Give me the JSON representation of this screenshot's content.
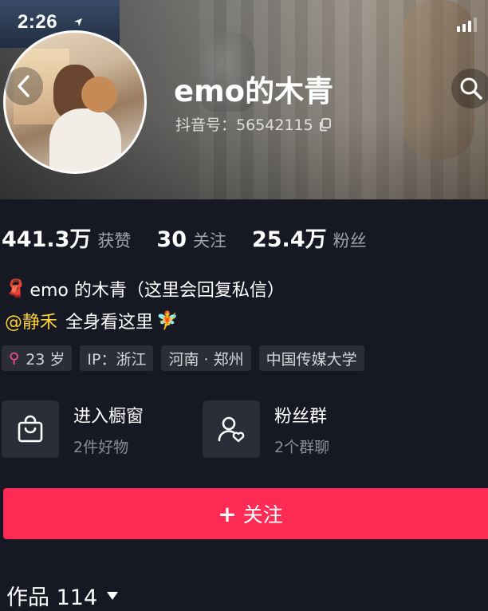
{
  "status_bar": {
    "time": "2:26"
  },
  "header": {
    "name": "emo的木青",
    "douyin_id": "抖音号：56542115"
  },
  "stats": [
    {
      "value": "441.3万",
      "label": "获赞"
    },
    {
      "value": "30",
      "label": "关注"
    },
    {
      "value": "25.4万",
      "label": "粉丝"
    }
  ],
  "bio": {
    "line1_emoji": "🧣",
    "line1_text": "emo 的木青（这里会回复私信）",
    "mention": "@静禾",
    "line2_text": "全身看这里",
    "line2_emoji": "🧚"
  },
  "tags": [
    {
      "icon": "female-symbol-icon",
      "text": "23 岁"
    },
    {
      "text": "IP：浙江"
    },
    {
      "text": "河南 · 郑州"
    },
    {
      "text": "中国传媒大学"
    }
  ],
  "cards": {
    "shop": {
      "title": "进入橱窗",
      "subtitle": "2件好物",
      "icon": "shopping-bag-icon"
    },
    "group": {
      "title": "粉丝群",
      "subtitle": "2个群聊",
      "icon": "fan-group-icon"
    }
  },
  "follow_button": {
    "plus": "+",
    "label": "关注"
  },
  "works": {
    "label": "作品 114"
  },
  "colors": {
    "background": "#161823",
    "follow": "#fe2c55",
    "mention": "#fad239",
    "tag_bg": "#2b2d38"
  }
}
